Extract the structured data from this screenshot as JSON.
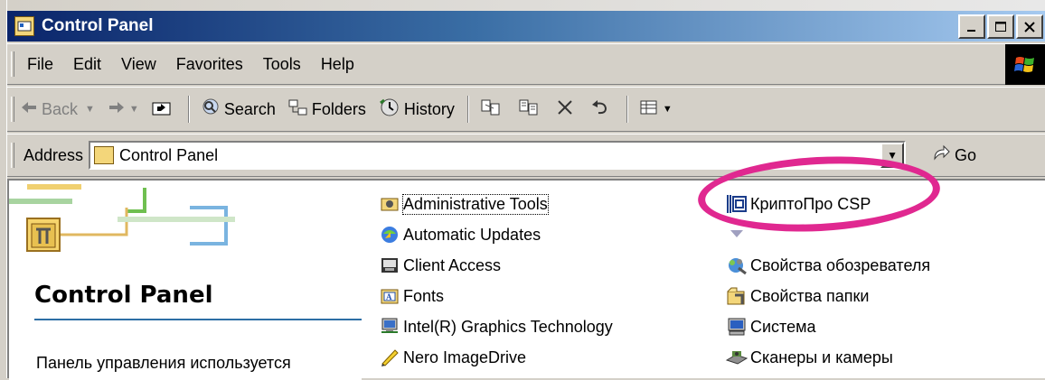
{
  "window": {
    "title": "Control Panel"
  },
  "menu": [
    "File",
    "Edit",
    "View",
    "Favorites",
    "Tools",
    "Help"
  ],
  "toolbar": {
    "back": "Back",
    "search": "Search",
    "folders": "Folders",
    "history": "History"
  },
  "address": {
    "label": "Address",
    "value": "Control Panel",
    "go": "Go"
  },
  "left_pane": {
    "title": "Control Panel",
    "description": "Панель управления используется"
  },
  "items_col1": [
    {
      "label": "Administrative Tools",
      "icon": "admin-tools-icon"
    },
    {
      "label": "Automatic Updates",
      "icon": "automatic-updates-icon"
    },
    {
      "label": "Client Access",
      "icon": "client-access-icon"
    },
    {
      "label": "Fonts",
      "icon": "fonts-icon"
    },
    {
      "label": "Intel(R) Graphics Technology",
      "icon": "intel-graphics-icon"
    },
    {
      "label": "Nero ImageDrive",
      "icon": "nero-imagedrive-icon"
    }
  ],
  "items_col2": [
    {
      "label": "КриптоПро CSP",
      "icon": "cryptopro-icon"
    },
    {
      "label": "Свойства обозревателя",
      "icon": "internet-options-icon"
    },
    {
      "label": "Свойства папки",
      "icon": "folder-options-icon"
    },
    {
      "label": "Система",
      "icon": "system-icon"
    },
    {
      "label": "Сканеры и камеры",
      "icon": "scanners-cameras-icon"
    }
  ],
  "colors": {
    "highlight_circle": "#e02890",
    "title_gradient_start": "#0a246a"
  }
}
